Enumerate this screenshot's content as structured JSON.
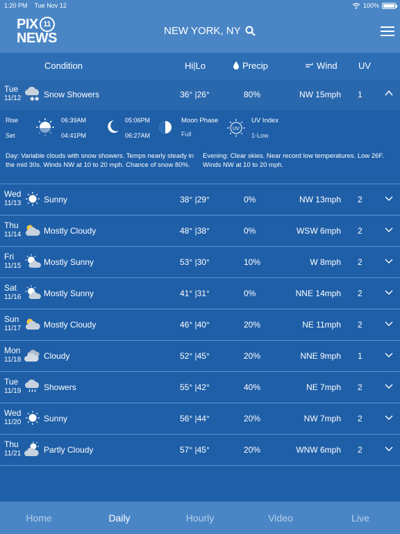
{
  "status_bar": {
    "time": "1:20 PM",
    "date": "Tue Nov 12",
    "battery": "100%",
    "battery_level": 1.0
  },
  "header": {
    "logo_line1": "PIX",
    "logo_eleven": "11",
    "logo_line2": "NEWS",
    "location": "NEW YORK, NY",
    "search_icon": "search-icon",
    "menu_icon": "hamburger-menu-icon"
  },
  "columns": {
    "condition": "Condition",
    "hilo": "Hi|Lo",
    "precip": "Precip",
    "wind": "Wind",
    "uv": "UV"
  },
  "expanded": {
    "day": "Tue",
    "date": "11/12",
    "icon": "snow-cloud-icon",
    "condition": "Snow Showers",
    "hilo": "36° |26°",
    "precip": "80%",
    "wind": "NW 15mph",
    "uv": "1",
    "rise_label": "Rise",
    "set_label": "Set",
    "sunrise": "06:39AM",
    "sunset": "04:41PM",
    "moonrise": "05:06PM",
    "moonset": "06:27AM",
    "moon_phase_label": "Moon Phase",
    "moon_phase": "Full",
    "uv_label": "UV Index",
    "uv_badge": "UV",
    "uv_value": "1-Low",
    "day_label": "Day",
    "day_text": ": Variable clouds with snow showers. Temps nearly steady in the mid 30s. Winds NW at 10 to 20 mph. Chance of snow 80%.",
    "evening_label": "Evening",
    "evening_text": ": Clear skies. Near record low temperatures. Low 26F. Winds NW at 10 to 20 mph."
  },
  "days": [
    {
      "day": "Wed",
      "date": "11/13",
      "icon": "sunny-icon",
      "condition": "Sunny",
      "hilo": "38° |29°",
      "precip": "0%",
      "wind": "NW 13mph",
      "uv": "2"
    },
    {
      "day": "Thu",
      "date": "11/14",
      "icon": "mostly-cloudy-icon",
      "condition": "Mostly Cloudy",
      "hilo": "48° |38°",
      "precip": "0%",
      "wind": "WSW 6mph",
      "uv": "2"
    },
    {
      "day": "Fri",
      "date": "11/15",
      "icon": "mostly-sunny-icon",
      "condition": "Mostly Sunny",
      "hilo": "53° |30°",
      "precip": "10%",
      "wind": "W 8mph",
      "uv": "2"
    },
    {
      "day": "Sat",
      "date": "11/16",
      "icon": "mostly-sunny-icon",
      "condition": "Mostly Sunny",
      "hilo": "41° |31°",
      "precip": "0%",
      "wind": "NNE 14mph",
      "uv": "2"
    },
    {
      "day": "Sun",
      "date": "11/17",
      "icon": "mostly-cloudy-icon",
      "condition": "Mostly Cloudy",
      "hilo": "46° |40°",
      "precip": "20%",
      "wind": "NE 11mph",
      "uv": "2"
    },
    {
      "day": "Mon",
      "date": "11/18",
      "icon": "cloudy-icon",
      "condition": "Cloudy",
      "hilo": "52° |45°",
      "precip": "20%",
      "wind": "NNE 9mph",
      "uv": "1"
    },
    {
      "day": "Tue",
      "date": "11/19",
      "icon": "showers-icon",
      "condition": "Showers",
      "hilo": "55° |42°",
      "precip": "40%",
      "wind": "NE 7mph",
      "uv": "2"
    },
    {
      "day": "Wed",
      "date": "11/20",
      "icon": "sunny-icon",
      "condition": "Sunny",
      "hilo": "56° |44°",
      "precip": "20%",
      "wind": "NW 7mph",
      "uv": "2"
    },
    {
      "day": "Thu",
      "date": "11/21",
      "icon": "partly-cloudy-icon",
      "condition": "Partly Cloudy",
      "hilo": "57° |45°",
      "precip": "20%",
      "wind": "WNW 6mph",
      "uv": "2"
    }
  ],
  "tabs": [
    {
      "label": "Home",
      "active": false
    },
    {
      "label": "Daily",
      "active": true
    },
    {
      "label": "Hourly",
      "active": false
    },
    {
      "label": "Video",
      "active": false
    },
    {
      "label": "Live",
      "active": false
    }
  ],
  "colors": {
    "background": "#1f5fa8",
    "header": "#4a86c6",
    "column_header": "#2d6db4",
    "divider": "#5b93cf",
    "inactive_tab": "#b7d0ea"
  }
}
